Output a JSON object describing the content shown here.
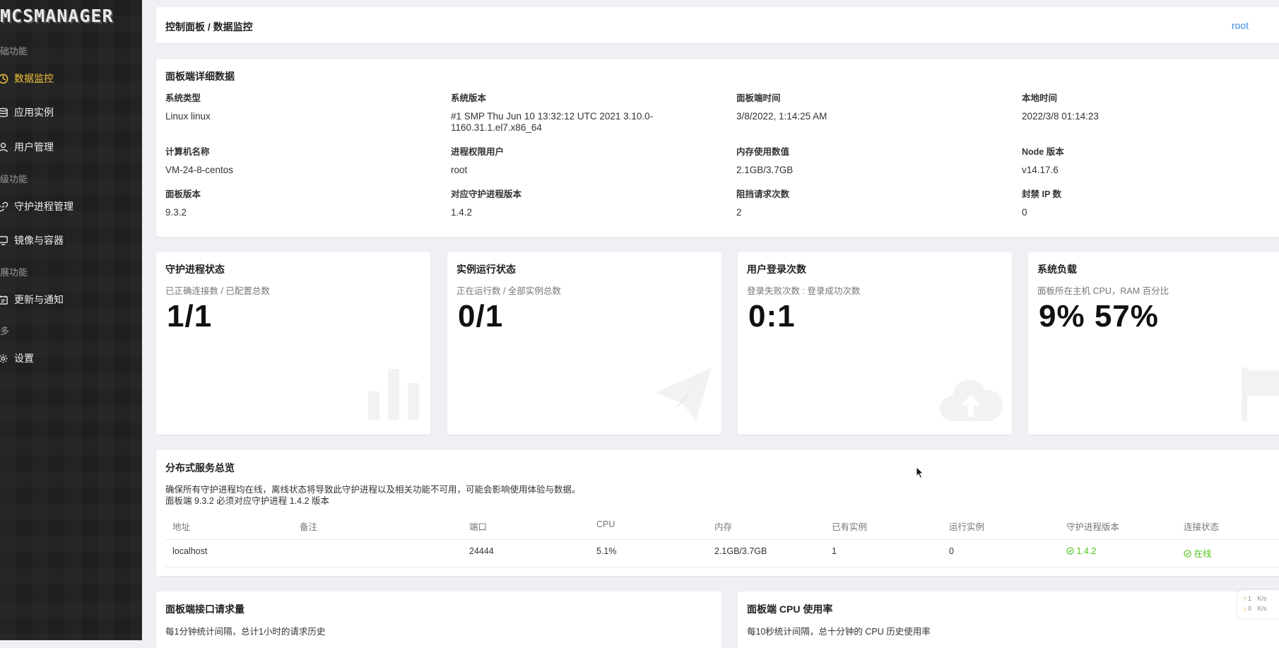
{
  "sidebar": {
    "logo": "MCSMANAGER",
    "groups": [
      {
        "label": "础功能"
      },
      {
        "label": "级功能"
      },
      {
        "label": "展功能"
      },
      {
        "label": "多"
      }
    ],
    "items": [
      {
        "label": "数据监控",
        "icon": "dashboard-icon",
        "active": true
      },
      {
        "label": "应用实例",
        "icon": "database-icon"
      },
      {
        "label": "用户管理",
        "icon": "user-icon"
      },
      {
        "label": "守护进程管理",
        "icon": "link-icon"
      },
      {
        "label": "镜像与容器",
        "icon": "monitor-icon"
      },
      {
        "label": "更新与通知",
        "icon": "notification-icon"
      },
      {
        "label": "设置",
        "icon": "gear-icon"
      }
    ]
  },
  "header": {
    "breadcrumb": "控制面板 / 数据监控",
    "user": "root"
  },
  "details": {
    "title": "面板端详细数据",
    "fields": [
      {
        "key": "系统类型",
        "value": "Linux linux"
      },
      {
        "key": "系统版本",
        "value": "#1 SMP Thu Jun 10 13:32:12 UTC 2021 3.10.0-",
        "value2": "1160.31.1.el7.x86_64"
      },
      {
        "key": "面板端时间",
        "value": "3/8/2022, 1:14:25 AM"
      },
      {
        "key": "本地时间",
        "value": "2022/3/8 01:14:23"
      },
      {
        "key": "计算机名称",
        "value": "VM-24-8-centos"
      },
      {
        "key": "进程权限用户",
        "value": "root"
      },
      {
        "key": "内存使用数值",
        "value": "2.1GB/3.7GB"
      },
      {
        "key": "Node 版本",
        "value": "v14.17.6"
      },
      {
        "key": "面板版本",
        "value": "9.3.2"
      },
      {
        "key": "对应守护进程版本",
        "value": "1.4.2"
      },
      {
        "key": "阻挡请求次数",
        "value": "2"
      },
      {
        "key": "封禁 IP 数",
        "value": "0"
      }
    ]
  },
  "stats": [
    {
      "title": "守护进程状态",
      "subtitle": "已正确连接数 / 已配置总数",
      "value": "1/1",
      "icon": "bar-chart-icon"
    },
    {
      "title": "实例运行状态",
      "subtitle": "正在运行数 / 全部实例总数",
      "value": "0/1",
      "icon": "paper-plane-icon"
    },
    {
      "title": "用户登录次数",
      "subtitle": "登录失败次数 : 登录成功次数",
      "value": "0:1",
      "icon": "cloud-upload-icon"
    },
    {
      "title": "系统负载",
      "subtitle": "面板所在主机 CPU，RAM 百分比",
      "value": "9% 57%",
      "icon": "flag-icon"
    }
  ],
  "distributed": {
    "title": "分布式服务总览",
    "desc1": "确保所有守护进程均在线，离线状态将导致此守护进程以及相关功能不可用，可能会影响使用体验与数据。",
    "desc2": "面板端 9.3.2 必须对应守护进程 1.4.2 版本",
    "columns": [
      "地址",
      "备注",
      "端口",
      "CPU",
      "内存",
      "已有实例",
      "运行实例",
      "守护进程版本",
      "连接状态"
    ],
    "rows": [
      {
        "address": "localhost",
        "remark": "",
        "port": "24444",
        "cpu": "5.1%",
        "memory": "2.1GB/3.7GB",
        "instances": "1",
        "running": "0",
        "version": "1.4.2",
        "status": "在线"
      }
    ]
  },
  "charts": [
    {
      "title": "面板端接口请求量",
      "subtitle": "每1分钟统计间隔，总计1小时的请求历史"
    },
    {
      "title": "面板端 CPU 使用率",
      "subtitle": "每10秒统计间隔，总十分钟的 CPU 历史使用率"
    }
  ],
  "network": {
    "up": "1",
    "down": "0",
    "unit": "K/s"
  }
}
